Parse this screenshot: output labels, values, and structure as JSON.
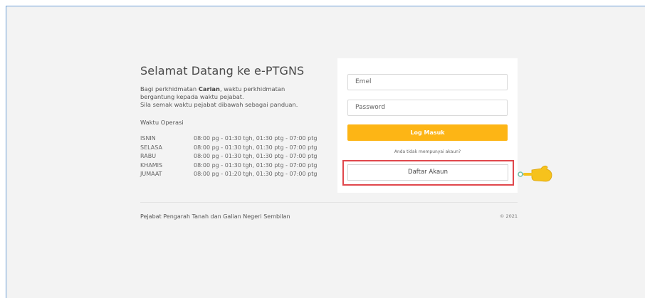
{
  "welcome": {
    "title": "Selamat Datang ke e-PTGNS",
    "intro_before": "Bagi perkhidmatan ",
    "intro_bold": "Carian",
    "intro_after": ", waktu perkhidmatan",
    "intro_line2": "bergantung kepada waktu pejabat.",
    "intro_line3": "Sila semak waktu pejabat dibawah sebagai panduan.",
    "operations_title": "Waktu Operasi",
    "hours": [
      {
        "day": "ISNIN",
        "time": "08:00 pg - 01:30 tgh, 01:30 ptg - 07:00 ptg"
      },
      {
        "day": "SELASA",
        "time": "08:00 pg - 01:30 tgh, 01:30 ptg - 07:00 ptg"
      },
      {
        "day": "RABU",
        "time": "08:00 pg - 01:30 tgh, 01:30 ptg - 07:00 ptg"
      },
      {
        "day": "KHAMIS",
        "time": "08:00 pg - 01:30 tgh, 01:30 ptg - 07:00 ptg"
      },
      {
        "day": "JUMAAT",
        "time": "08:00 pg - 01:20 tgh, 01:30 ptg - 07:00 ptg"
      }
    ]
  },
  "login": {
    "email_placeholder": "Emel",
    "password_placeholder": "Password",
    "login_button": "Log Masuk",
    "no_account_text": "Anda tidak mempunyai akaun?",
    "register_button": "Daftar Akaun"
  },
  "footer": {
    "office": "Pejabat Pengarah Tanah dan Galian Negeri Sembilan",
    "copyright": "© 2021"
  },
  "icons": {
    "pointer": "pointing-hand-icon"
  },
  "colors": {
    "accent": "#fdb515",
    "highlight": "#e0474c",
    "frame_border": "#6a9fd6",
    "background": "#f3f3f3"
  }
}
